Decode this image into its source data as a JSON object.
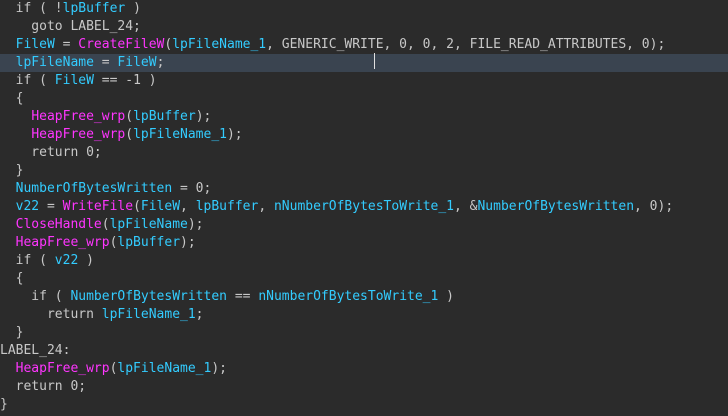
{
  "colors": {
    "background": "#2b2b2b",
    "highlight_line": "#3a4450",
    "plain_text": "#c8c8c8",
    "variable": "#33ccff",
    "function": "#ff35ff"
  },
  "code_lines": [
    {
      "tokens": [
        [
          "pl",
          "  if ( !"
        ],
        [
          "id",
          "lpBuffer"
        ],
        [
          "pl",
          " )"
        ]
      ]
    },
    {
      "tokens": [
        [
          "pl",
          "    goto LABEL_24;"
        ]
      ]
    },
    {
      "tokens": [
        [
          "pl",
          "  "
        ],
        [
          "id",
          "FileW"
        ],
        [
          "pl",
          " = "
        ],
        [
          "fn",
          "CreateFileW"
        ],
        [
          "pl",
          "("
        ],
        [
          "id",
          "lpFileName_1"
        ],
        [
          "pl",
          ", GENERIC_WRITE, 0, 0, 2, FILE_READ_ATTRIBUTES, 0);"
        ]
      ]
    },
    {
      "tokens": [
        [
          "pl",
          "  "
        ],
        [
          "id",
          "lpFileName"
        ],
        [
          "pl",
          " = "
        ],
        [
          "id",
          "FileW"
        ],
        [
          "pl",
          ";"
        ]
      ],
      "highlight": true
    },
    {
      "tokens": [
        [
          "pl",
          "  if ( "
        ],
        [
          "id",
          "FileW"
        ],
        [
          "pl",
          " == -1 )"
        ]
      ]
    },
    {
      "tokens": [
        [
          "pl",
          "  {"
        ]
      ]
    },
    {
      "tokens": [
        [
          "pl",
          "    "
        ],
        [
          "fn",
          "HeapFree_wrp"
        ],
        [
          "pl",
          "("
        ],
        [
          "id",
          "lpBuffer"
        ],
        [
          "pl",
          ");"
        ]
      ]
    },
    {
      "tokens": [
        [
          "pl",
          "    "
        ],
        [
          "fn",
          "HeapFree_wrp"
        ],
        [
          "pl",
          "("
        ],
        [
          "id",
          "lpFileName_1"
        ],
        [
          "pl",
          ");"
        ]
      ]
    },
    {
      "tokens": [
        [
          "pl",
          "    return 0;"
        ]
      ]
    },
    {
      "tokens": [
        [
          "pl",
          "  }"
        ]
      ]
    },
    {
      "tokens": [
        [
          "pl",
          "  "
        ],
        [
          "id",
          "NumberOfBytesWritten"
        ],
        [
          "pl",
          " = 0;"
        ]
      ]
    },
    {
      "tokens": [
        [
          "pl",
          "  "
        ],
        [
          "id",
          "v22"
        ],
        [
          "pl",
          " = "
        ],
        [
          "fn",
          "WriteFile"
        ],
        [
          "pl",
          "("
        ],
        [
          "id",
          "FileW"
        ],
        [
          "pl",
          ", "
        ],
        [
          "id",
          "lpBuffer"
        ],
        [
          "pl",
          ", "
        ],
        [
          "id",
          "nNumberOfBytesToWrite_1"
        ],
        [
          "pl",
          ", &"
        ],
        [
          "id",
          "NumberOfBytesWritten"
        ],
        [
          "pl",
          ", 0);"
        ]
      ]
    },
    {
      "tokens": [
        [
          "pl",
          "  "
        ],
        [
          "fn",
          "CloseHandle"
        ],
        [
          "pl",
          "("
        ],
        [
          "id",
          "lpFileName"
        ],
        [
          "pl",
          ");"
        ]
      ]
    },
    {
      "tokens": [
        [
          "pl",
          "  "
        ],
        [
          "fn",
          "HeapFree_wrp"
        ],
        [
          "pl",
          "("
        ],
        [
          "id",
          "lpBuffer"
        ],
        [
          "pl",
          ");"
        ]
      ]
    },
    {
      "tokens": [
        [
          "pl",
          "  if ( "
        ],
        [
          "id",
          "v22"
        ],
        [
          "pl",
          " )"
        ]
      ]
    },
    {
      "tokens": [
        [
          "pl",
          "  {"
        ]
      ]
    },
    {
      "tokens": [
        [
          "pl",
          "    if ( "
        ],
        [
          "id",
          "NumberOfBytesWritten"
        ],
        [
          "pl",
          " == "
        ],
        [
          "id",
          "nNumberOfBytesToWrite_1"
        ],
        [
          "pl",
          " )"
        ]
      ]
    },
    {
      "tokens": [
        [
          "pl",
          "      return "
        ],
        [
          "id",
          "lpFileName_1"
        ],
        [
          "pl",
          ";"
        ]
      ]
    },
    {
      "tokens": [
        [
          "pl",
          "  }"
        ]
      ]
    },
    {
      "tokens": [
        [
          "lbl",
          "LABEL_24:"
        ]
      ]
    },
    {
      "tokens": [
        [
          "pl",
          "  "
        ],
        [
          "fn",
          "HeapFree_wrp"
        ],
        [
          "pl",
          "("
        ],
        [
          "id",
          "lpFileName_1"
        ],
        [
          "pl",
          ");"
        ]
      ]
    },
    {
      "tokens": [
        [
          "pl",
          "  return 0;"
        ]
      ]
    },
    {
      "tokens": [
        [
          "pl",
          "}"
        ]
      ]
    }
  ]
}
